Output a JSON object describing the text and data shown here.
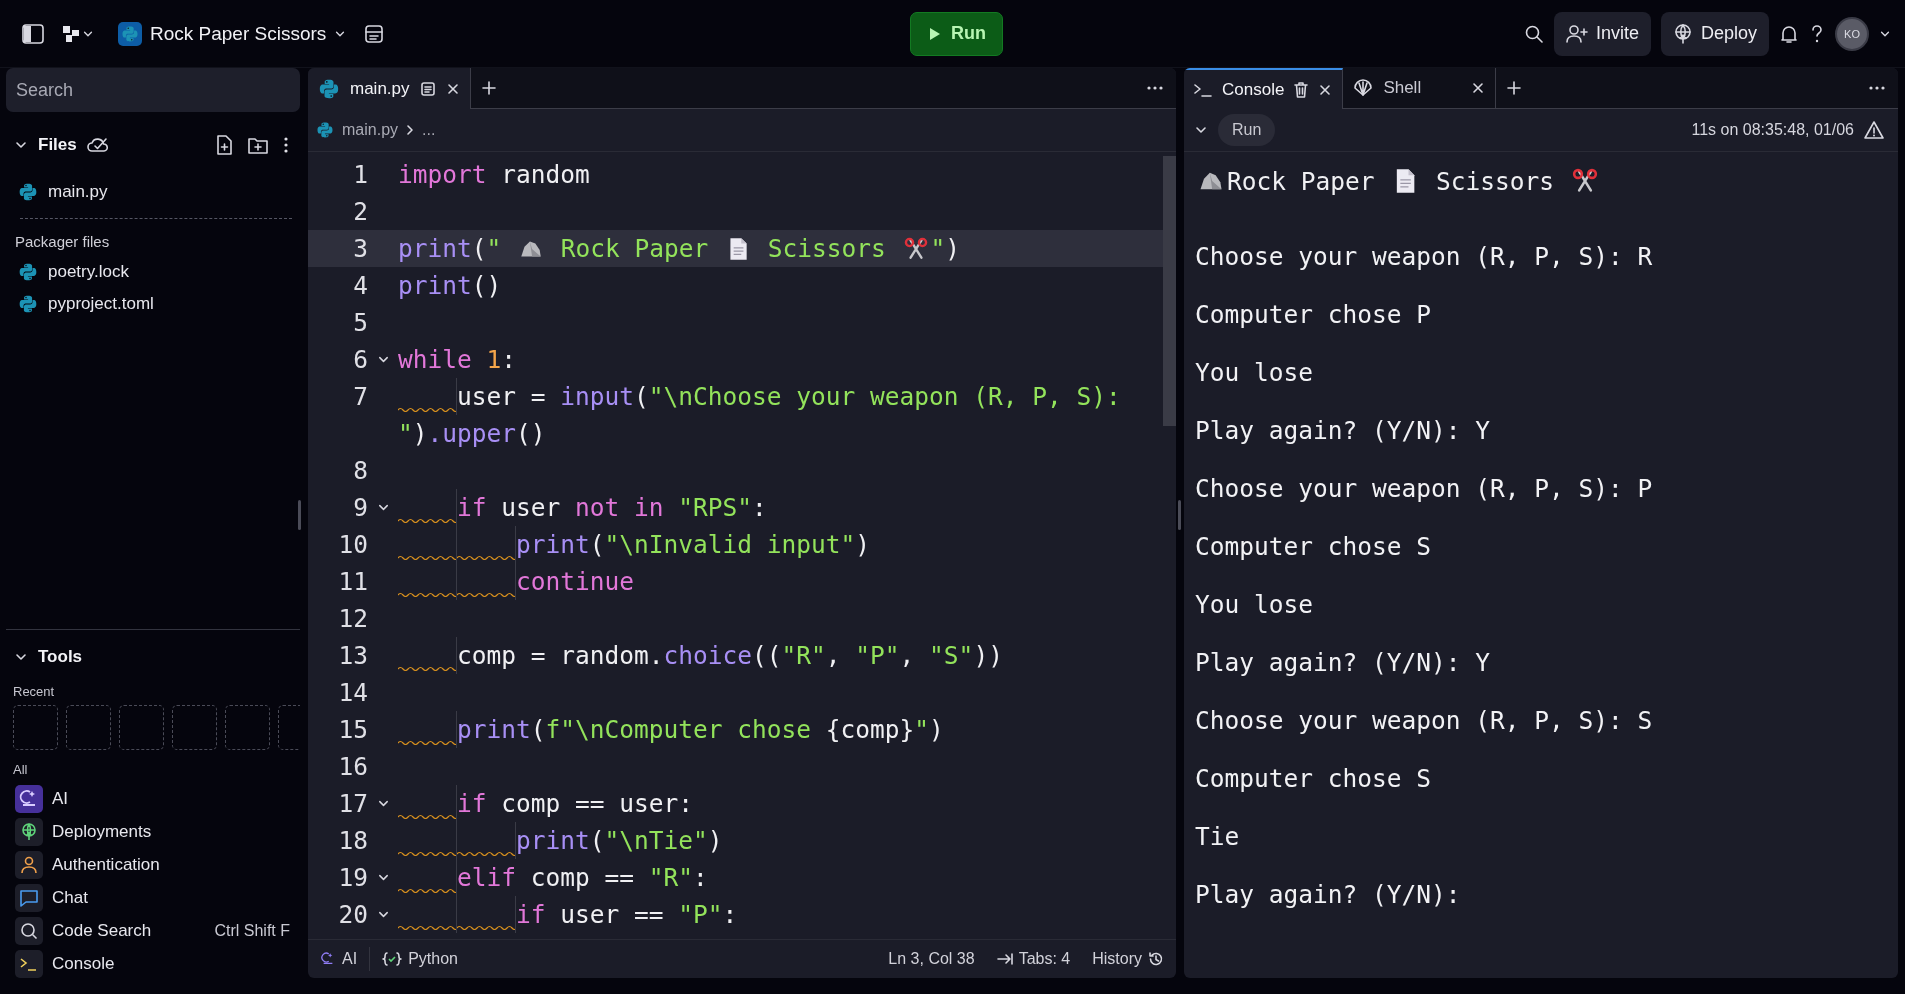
{
  "topbar": {
    "project": "Rock Paper Scissors",
    "run": "Run",
    "invite": "Invite",
    "deploy": "Deploy",
    "avatar": "KO"
  },
  "sidebar": {
    "search_placeholder": "Search",
    "files_title": "Files",
    "files": [
      {
        "name": "main.py"
      }
    ],
    "packager_title": "Packager files",
    "packager_files": [
      {
        "name": "poetry.lock"
      },
      {
        "name": "pyproject.toml"
      }
    ],
    "tools_title": "Tools",
    "recent_label": "Recent",
    "all_label": "All",
    "tools": [
      {
        "name": "AI",
        "kind": "ai"
      },
      {
        "name": "Deployments",
        "kind": "deployments"
      },
      {
        "name": "Authentication",
        "kind": "auth"
      },
      {
        "name": "Chat",
        "kind": "chat"
      },
      {
        "name": "Code Search",
        "kind": "search",
        "shortcut": "Ctrl Shift F"
      },
      {
        "name": "Console",
        "kind": "console"
      }
    ]
  },
  "editor": {
    "tabs": [
      {
        "label": "main.py",
        "selected": true
      }
    ],
    "breadcrumb": [
      "main.py",
      "..."
    ],
    "lines": [
      {
        "n": "1",
        "current": false,
        "fold": false,
        "tokens": [
          {
            "kind": "keyword",
            "text": "import"
          },
          {
            "kind": "plain",
            "text": " random"
          }
        ]
      },
      {
        "n": "2",
        "current": false,
        "fold": false
      },
      {
        "n": "3",
        "current": true,
        "fold": false,
        "tokens": [
          {
            "kind": "function",
            "text": "print"
          },
          {
            "kind": "plain",
            "text": "("
          },
          {
            "kind": "string",
            "text": "\" "
          },
          {
            "kind": "rock"
          },
          {
            "kind": "string",
            "text": " Rock Paper "
          },
          {
            "kind": "paper"
          },
          {
            "kind": "string",
            "text": " Scissors "
          },
          {
            "kind": "scissors"
          },
          {
            "kind": "string",
            "text": "\""
          },
          {
            "kind": "plain",
            "text": ")"
          }
        ]
      },
      {
        "n": "4",
        "current": false,
        "fold": false,
        "tokens": [
          {
            "kind": "function",
            "text": "print"
          },
          {
            "kind": "plain",
            "text": "()"
          }
        ]
      },
      {
        "n": "5",
        "current": false,
        "fold": false
      },
      {
        "n": "6",
        "current": false,
        "fold": true,
        "tokens": [
          {
            "kind": "keyword",
            "text": "while"
          },
          {
            "kind": "number",
            "text": " 1"
          },
          {
            "kind": "plain",
            "text": ":"
          }
        ]
      },
      {
        "n": "7",
        "current": false,
        "fold": false,
        "tokens": [
          {
            "kind": "indent"
          },
          {
            "kind": "plain",
            "text": "user = "
          },
          {
            "kind": "function",
            "text": "input"
          },
          {
            "kind": "plain",
            "text": "("
          },
          {
            "kind": "string",
            "text": "\"\\nChoose your weapon (R, P, S): "
          }
        ],
        "wrap": [
          {
            "kind": "string",
            "text": "\""
          },
          {
            "kind": "plain",
            "text": ")"
          },
          {
            "kind": "function",
            "text": ".upper"
          },
          {
            "kind": "plain",
            "text": "()"
          }
        ]
      },
      {
        "n": "8",
        "current": false,
        "fold": false
      },
      {
        "n": "9",
        "current": false,
        "fold": true,
        "tokens": [
          {
            "kind": "indent"
          },
          {
            "kind": "keyword",
            "text": "if"
          },
          {
            "kind": "plain",
            "text": " user "
          },
          {
            "kind": "keyword",
            "text": "not in"
          },
          {
            "kind": "string",
            "text": " \"RPS\""
          },
          {
            "kind": "plain",
            "text": ":"
          }
        ]
      },
      {
        "n": "10",
        "current": false,
        "fold": false,
        "tokens": [
          {
            "kind": "indent"
          },
          {
            "kind": "indent"
          },
          {
            "kind": "function",
            "text": "print"
          },
          {
            "kind": "plain",
            "text": "("
          },
          {
            "kind": "string",
            "text": "\"\\nInvalid input\""
          },
          {
            "kind": "plain",
            "text": ")"
          }
        ]
      },
      {
        "n": "11",
        "current": false,
        "fold": false,
        "tokens": [
          {
            "kind": "indent"
          },
          {
            "kind": "indent"
          },
          {
            "kind": "keyword",
            "text": "continue"
          }
        ]
      },
      {
        "n": "12",
        "current": false,
        "fold": false
      },
      {
        "n": "13",
        "current": false,
        "fold": false,
        "tokens": [
          {
            "kind": "indent"
          },
          {
            "kind": "plain",
            "text": "comp = random."
          },
          {
            "kind": "function",
            "text": "choice"
          },
          {
            "kind": "plain",
            "text": "(("
          },
          {
            "kind": "string",
            "text": "\"R\""
          },
          {
            "kind": "plain",
            "text": ", "
          },
          {
            "kind": "string",
            "text": "\"P\""
          },
          {
            "kind": "plain",
            "text": ", "
          },
          {
            "kind": "string",
            "text": "\"S\""
          },
          {
            "kind": "plain",
            "text": "))"
          }
        ]
      },
      {
        "n": "14",
        "current": false,
        "fold": false
      },
      {
        "n": "15",
        "current": false,
        "fold": false,
        "tokens": [
          {
            "kind": "indent"
          },
          {
            "kind": "function",
            "text": "print"
          },
          {
            "kind": "plain",
            "text": "("
          },
          {
            "kind": "string",
            "text": "f\"\\nComputer chose "
          },
          {
            "kind": "plain",
            "text": "{comp}"
          },
          {
            "kind": "string",
            "text": "\""
          },
          {
            "kind": "plain",
            "text": ")"
          }
        ]
      },
      {
        "n": "16",
        "current": false,
        "fold": false
      },
      {
        "n": "17",
        "current": false,
        "fold": true,
        "tokens": [
          {
            "kind": "indent"
          },
          {
            "kind": "keyword",
            "text": "if"
          },
          {
            "kind": "plain",
            "text": " comp == user:"
          }
        ]
      },
      {
        "n": "18",
        "current": false,
        "fold": false,
        "tokens": [
          {
            "kind": "indent"
          },
          {
            "kind": "indent"
          },
          {
            "kind": "function",
            "text": "print"
          },
          {
            "kind": "plain",
            "text": "("
          },
          {
            "kind": "string",
            "text": "\"\\nTie\""
          },
          {
            "kind": "plain",
            "text": ")"
          }
        ]
      },
      {
        "n": "19",
        "current": false,
        "fold": true,
        "tokens": [
          {
            "kind": "indent"
          },
          {
            "kind": "keyword",
            "text": "elif"
          },
          {
            "kind": "plain",
            "text": " comp == "
          },
          {
            "kind": "string",
            "text": "\"R\""
          },
          {
            "kind": "plain",
            "text": ":"
          }
        ]
      },
      {
        "n": "20",
        "current": false,
        "fold": true,
        "tokens": [
          {
            "kind": "indent"
          },
          {
            "kind": "indent"
          },
          {
            "kind": "keyword",
            "text": "if"
          },
          {
            "kind": "plain",
            "text": " user == "
          },
          {
            "kind": "string",
            "text": "\"P\""
          },
          {
            "kind": "plain",
            "text": ":"
          }
        ]
      }
    ],
    "status": {
      "ai": "AI",
      "language": "Python",
      "position": "Ln 3, Col 38",
      "tabs": "Tabs: 4",
      "history": "History"
    }
  },
  "console": {
    "tabs": [
      {
        "label": "Console",
        "kind": "console",
        "selected": true
      },
      {
        "label": "Shell",
        "kind": "shell",
        "selected": false
      }
    ],
    "run": "Run",
    "timestamp": "11s on 08:35:48, 01/06",
    "output": [
      {
        "tokens": [
          {
            "kind": "rock"
          },
          {
            "kind": "plain",
            "text": "Rock Paper "
          },
          {
            "kind": "paper"
          },
          {
            "kind": "plain",
            "text": " Scissors "
          },
          {
            "kind": "scissors"
          }
        ]
      },
      {
        "text": "Choose your weapon (R, P, S): R"
      },
      {
        "text": "Computer chose P"
      },
      {
        "text": "You lose"
      },
      {
        "text": "Play again? (Y/N): Y"
      },
      {
        "text": "Choose your weapon (R, P, S): P"
      },
      {
        "text": "Computer chose S"
      },
      {
        "text": "You lose"
      },
      {
        "text": "Play again? (Y/N): Y"
      },
      {
        "text": "Choose your weapon (R, P, S): S"
      },
      {
        "text": "Computer chose S"
      },
      {
        "text": "Tie"
      },
      {
        "text": "Play again? (Y/N):"
      }
    ]
  }
}
